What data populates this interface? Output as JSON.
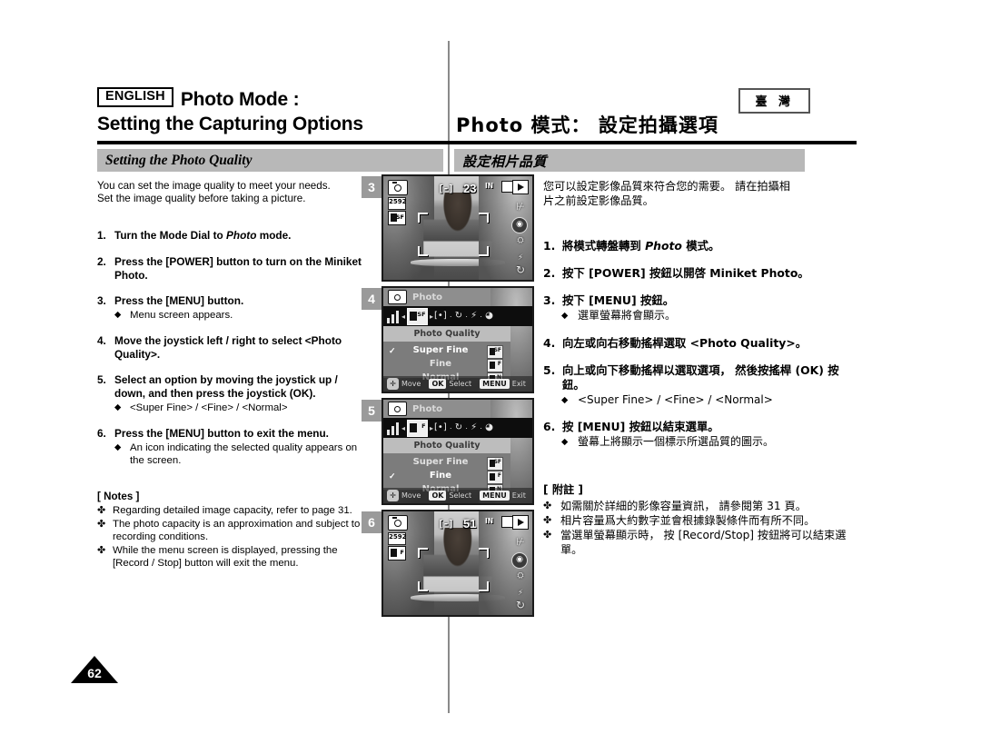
{
  "header": {
    "lang_badge": "ENGLISH",
    "title_line1": "Photo Mode :",
    "title_line2": "Setting the Capturing Options",
    "region_badge": "臺 灣",
    "title_chinese": "Photo 模式： 設定拍攝選項"
  },
  "section": {
    "eng_label": "Setting the Photo Quality",
    "chi_label": "設定相片品質"
  },
  "english": {
    "intro_line1": "You can set the image quality to meet your needs.",
    "intro_line2": "Set the image quality before taking a picture.",
    "steps": [
      {
        "num": "1.",
        "text_before": "Turn the Mode Dial to ",
        "text_italic": "Photo",
        "text_after": " mode."
      },
      {
        "num": "2.",
        "text": "Press the [POWER] button to turn on the Miniket Photo."
      },
      {
        "num": "3.",
        "text": "Press the [MENU] button.",
        "sub": "Menu screen appears."
      },
      {
        "num": "4.",
        "text": "Move the joystick left / right to select <Photo Quality>."
      },
      {
        "num": "5.",
        "text": "Select an option by moving the joystick up / down, and then press the joystick (OK).",
        "sub": "<Super Fine> / <Fine> / <Normal>"
      },
      {
        "num": "6.",
        "text": "Press the [MENU] button to exit the menu.",
        "sub": "An icon indicating the selected quality appears on the screen."
      }
    ],
    "notes_title": "[ Notes ]",
    "notes": [
      "Regarding detailed image capacity, refer to page 31.",
      "The photo capacity is an approximation and subject to recording conditions.",
      "While the menu screen is displayed, pressing the [Record / Stop] button will exit the menu."
    ]
  },
  "chinese": {
    "intro_line1": "您可以設定影像品質來符合您的需要。 請在拍攝相",
    "intro_line2": "片之前設定影像品質。",
    "steps": [
      {
        "num": "1.",
        "text_before": "將模式轉盤轉到 ",
        "text_italic": "Photo",
        "text_after": " 模式。"
      },
      {
        "num": "2.",
        "text": "按下 [POWER] 按鈕以開啓 Miniket Photo。"
      },
      {
        "num": "3.",
        "text": "按下 [MENU] 按鈕。",
        "sub": "選單螢幕將會顯示。"
      },
      {
        "num": "4.",
        "text": "向左或向右移動搖桿選取 <Photo Quality>。"
      },
      {
        "num": "5.",
        "text": "向上或向下移動搖桿以選取選項， 然後按搖桿 (OK) 按鈕。",
        "sub": "<Super Fine> / <Fine> / <Normal>"
      },
      {
        "num": "6.",
        "text": "按 [MENU] 按鈕以結束選單。",
        "sub": "螢幕上將顯示一個標示所選品質的圖示。"
      }
    ],
    "notes_title": "[ 附註 ]",
    "notes": [
      "如需關於詳細的影像容量資訊， 請參閱第 31 頁。",
      "相片容量爲大約數字並會根據錄製條件而有所不同。",
      "當選單螢幕顯示時， 按 [Record/Stop] 按鈕將可以結束選單。"
    ]
  },
  "figures": [
    {
      "num": "3",
      "type": "preview",
      "shot_count": "23",
      "res_label": "2592",
      "quality_letter": "SF",
      "memory_label": "IN",
      "focus_icon": "[-]"
    },
    {
      "num": "4",
      "type": "menu",
      "title": "Photo",
      "submenu_title": "Photo Quality",
      "options": [
        {
          "label": "Super Fine",
          "icon_letter": "SF",
          "selected": true
        },
        {
          "label": "Fine",
          "icon_letter": "F",
          "selected": false
        },
        {
          "label": "Normal",
          "icon_letter": "N",
          "selected": false
        }
      ],
      "bottom_bar": {
        "move": "Move",
        "ok_key": "OK",
        "ok_label": "Select",
        "menu_key": "MENU",
        "menu_label": "Exit"
      },
      "selected_icon_letter": "SF"
    },
    {
      "num": "5",
      "type": "menu",
      "title": "Photo",
      "submenu_title": "Photo Quality",
      "options": [
        {
          "label": "Super Fine",
          "icon_letter": "SF",
          "selected": false
        },
        {
          "label": "Fine",
          "icon_letter": "F",
          "selected": true
        },
        {
          "label": "Normal",
          "icon_letter": "N",
          "selected": false
        }
      ],
      "bottom_bar": {
        "move": "Move",
        "ok_key": "OK",
        "ok_label": "Select",
        "menu_key": "MENU",
        "menu_label": "Exit"
      },
      "selected_icon_letter": "F"
    },
    {
      "num": "6",
      "type": "preview",
      "shot_count": "51",
      "res_label": "2592",
      "quality_letter": "F",
      "memory_label": "IN",
      "focus_icon": "[-]"
    }
  ],
  "page_number": "62",
  "icons": {
    "diamond": "◆",
    "clover": "✤",
    "check": "✓",
    "joystick": "✛",
    "dot_sep": "·",
    "left_arrow": "◂",
    "right_arrow": "▸",
    "focus_dot": "[•]",
    "timer": "↻",
    "flash": "⚡",
    "wb": "◕"
  }
}
